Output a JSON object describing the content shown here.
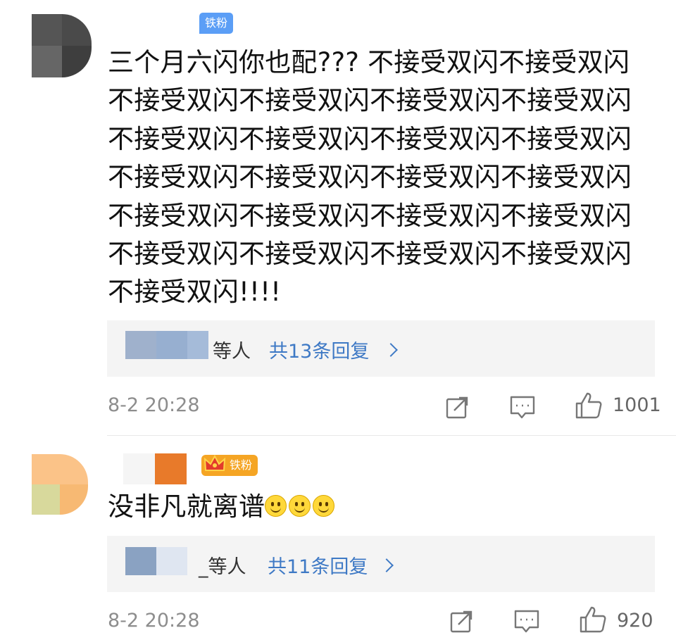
{
  "comments": [
    {
      "badge": "铁粉",
      "text": "三个月六闪你也配??? 不接受双闪不接受双闪不接受双闪不接受双闪不接受双闪不接受双闪不接受双闪不接受双闪不接受双闪不接受双闪不接受双闪不接受双闪不接受双闪不接受双闪不接受双闪不接受双闪不接受双闪不接受双闪不接受双闪不接受双闪不接受双闪不接受双闪不接受双闪!!!!",
      "replies": {
        "who_suffix": "等人",
        "count_label": "共13条回复"
      },
      "time": "8-2 20:28",
      "likes": "1001",
      "icons": [
        "share-icon",
        "comment-icon",
        "like-icon"
      ]
    },
    {
      "badge": "铁粉",
      "text": "没非凡就离谱",
      "emoji_count": 3,
      "replies": {
        "who_suffix": "_等人",
        "count_label": "共11条回复"
      },
      "time": "8-2 20:28",
      "likes": "920",
      "icons": [
        "share-icon",
        "comment-icon",
        "like-icon"
      ]
    }
  ],
  "colors": {
    "badge_blue": "#5b9ef6",
    "badge_gold": "#f5a524",
    "link_blue": "#3e79c5",
    "reply_bg": "#f4f4f4",
    "meta_gray": "#8d8d8d"
  }
}
